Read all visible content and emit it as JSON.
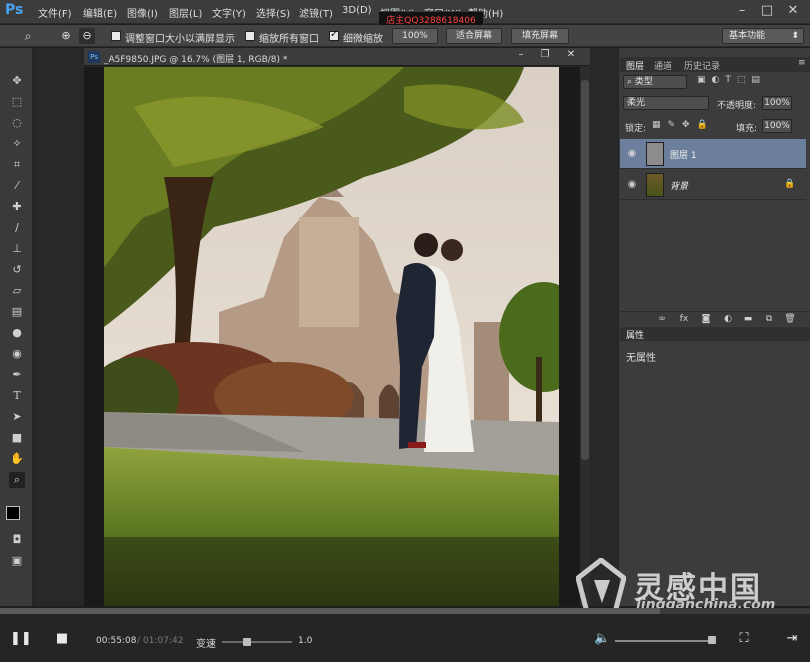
{
  "app": {
    "logo": "Ps"
  },
  "menu": [
    "文件(F)",
    "编辑(E)",
    "图像(I)",
    "图层(L)",
    "文字(Y)",
    "选择(S)",
    "滤镜(T)",
    "3D(D)",
    "视图(V)",
    "窗口(W)",
    "帮助(H)"
  ],
  "qq_banner": "店主QQ3288618406",
  "options": {
    "resize_label": "调整窗口大小以满屏显示",
    "resize_checked": false,
    "zoom_all_label": "缩放所有窗口",
    "zoom_all_checked": false,
    "scrubby_label": "细微缩放",
    "scrubby_checked": true,
    "btn_100": "100%",
    "btn_fit": "适合屏幕",
    "btn_fill": "填充屏幕",
    "workspace": "基本功能"
  },
  "tools": [
    "move-icon",
    "marquee-icon",
    "lasso-icon",
    "magic-wand-icon",
    "crop-icon",
    "eyedropper-icon",
    "healing-brush-icon",
    "brush-icon",
    "clone-stamp-icon",
    "history-brush-icon",
    "eraser-icon",
    "gradient-icon",
    "blur-icon",
    "dodge-icon",
    "pen-icon",
    "type-icon",
    "path-selection-icon",
    "rectangle-icon",
    "hand-icon",
    "zoom-icon"
  ],
  "document": {
    "title": "_A5F9850.JPG @ 16.7% (图层 1, RGB/8) *"
  },
  "layers_panel": {
    "tabs": [
      "图层",
      "通道",
      "历史记录"
    ],
    "filter_kind": "类型",
    "blend_mode": "柔光",
    "opacity_label": "不透明度:",
    "opacity": "100%",
    "lock_label": "锁定:",
    "fill_label": "填充:",
    "fill": "100%",
    "layers": [
      {
        "name": "图层 1",
        "selected": true
      },
      {
        "name": "背景",
        "selected": false,
        "locked": true
      }
    ]
  },
  "properties_panel": {
    "title": "属性",
    "content": "无属性"
  },
  "watermark": {
    "text": "灵感中国",
    "url": "lingganchina.com"
  },
  "player": {
    "current_time": "00:55:08",
    "total_time": "01:07:42",
    "speed_label": "变速",
    "speed_value": "1.0",
    "progress": 0.815
  }
}
